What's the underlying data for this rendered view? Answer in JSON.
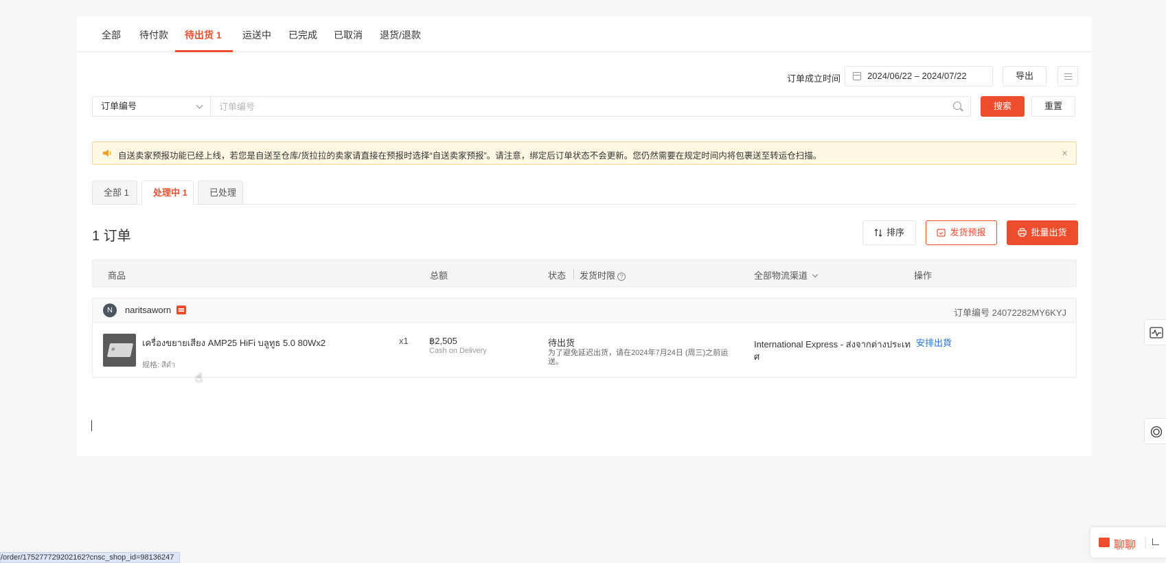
{
  "status_tabs": [
    {
      "label": "全部"
    },
    {
      "label": "待付款"
    },
    {
      "label": "待出货 1"
    },
    {
      "label": "运送中"
    },
    {
      "label": "已完成"
    },
    {
      "label": "已取消"
    },
    {
      "label": "退货/退款"
    }
  ],
  "filter": {
    "date_label": "订单成立时间",
    "date_range": "2024/06/22 – 2024/07/22",
    "export_label": "导出",
    "select_value": "订单编号",
    "search_placeholder": "订单编号",
    "search_label": "搜索",
    "reset_label": "重置"
  },
  "notice": {
    "text": "自送卖家预报功能已经上线，若您是自送至仓库/货拉拉的卖家请直接在预报时选择“自送卖家预报”。请注意，绑定后订单状态不会更新。您仍然需要在规定时间内将包裹送至转运仓扫描。",
    "close": "×"
  },
  "sub_tabs": [
    {
      "label": "全部 1"
    },
    {
      "label": "处理中 1"
    },
    {
      "label": "已处理"
    }
  ],
  "order_count": "1 订单",
  "actions": {
    "sort": "排序",
    "forecast": "发货预报",
    "bulk_ship": "批量出货"
  },
  "table_header": {
    "product": "商品",
    "total": "总额",
    "status": "状态",
    "deadline": "发货时限",
    "help": "?",
    "channel": "全部物流渠道",
    "ops": "操作"
  },
  "order": {
    "avatar_letter": "N",
    "buyer": "naritsaworn",
    "order_no": "订单编号 24072282MY6KYJ",
    "product_name": "เครื่องขยายเสียง AMP25 HiFi บลูทูธ 5.0 80Wx2",
    "variant": "规格: สีดำ",
    "qty": "x1",
    "amount": "฿2,505",
    "payment": "Cash on Delivery",
    "status": "待出货",
    "status_note_1": "为了避免延迟出货，请在2024年7月24日 (周三)之前运",
    "status_note_2": "送。",
    "channel_1": "International Express - ส่งจากต่างประเท",
    "channel_2": "ศ",
    "op": "安排出貨"
  },
  "chat_widget": {
    "label": "聊聊"
  },
  "status_url": "/order/175277729202162?cnsc_shop_id=98136247",
  "colors": {
    "accent": "#ee4d2d",
    "link": "#2673dd",
    "notice_bg": "#fff8e3"
  }
}
